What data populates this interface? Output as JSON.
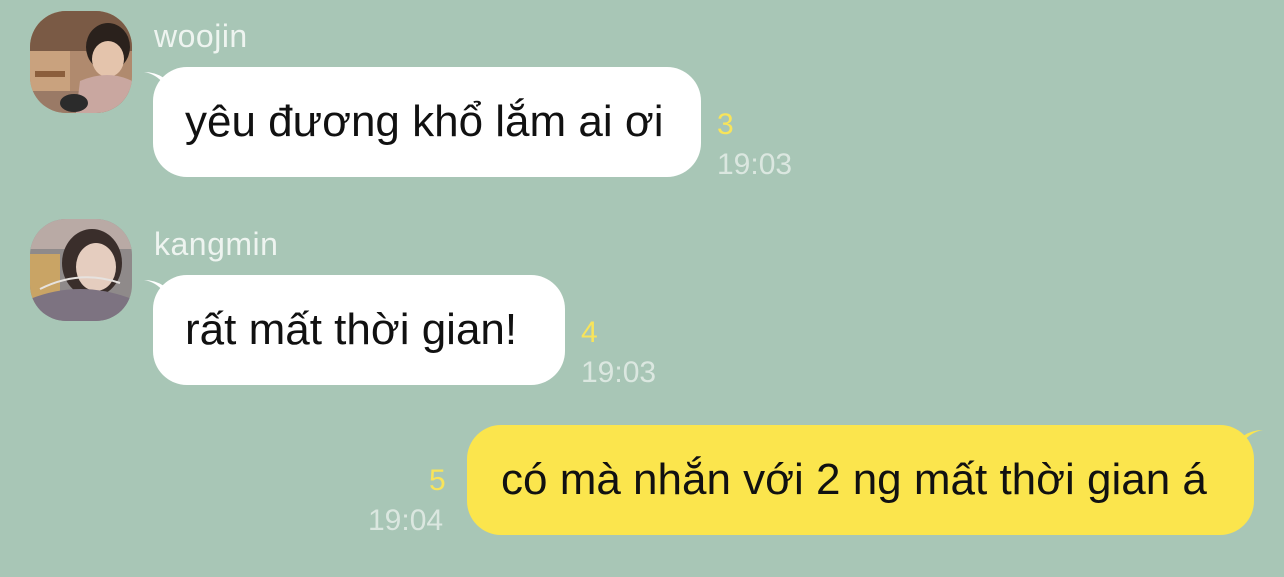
{
  "colors": {
    "background": "#a8c6b6",
    "incoming_bubble": "#ffffff",
    "outgoing_bubble": "#fbe54d",
    "unread_count": "#f8e45a",
    "timestamp": "#dbe7e0"
  },
  "messages": [
    {
      "sender": "woojin",
      "text": "yêu đương khổ lắm ai ơi",
      "unread": "3",
      "time": "19:03",
      "direction": "incoming",
      "avatar_icon": "profile-photo-woojin"
    },
    {
      "sender": "kangmin",
      "text": "rất mất thời gian!",
      "unread": "4",
      "time": "19:03",
      "direction": "incoming",
      "avatar_icon": "profile-photo-kangmin"
    },
    {
      "text": "có mà nhắn với 2 ng mất thời gian á",
      "unread": "5",
      "time": "19:04",
      "direction": "outgoing"
    }
  ]
}
